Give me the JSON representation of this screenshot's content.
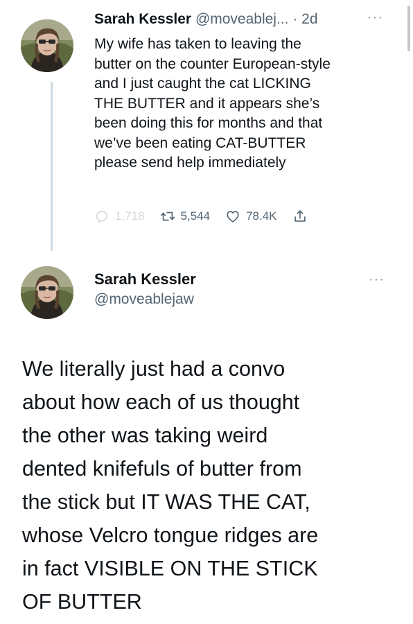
{
  "tweet1": {
    "author_name": "Sarah Kessler",
    "handle": "@moveablej...",
    "separator": "·",
    "time": "2d",
    "more": "···",
    "lines": [
      "My wife has taken to leaving the",
      "butter on the counter European-style",
      "and I just caught the cat LICKING",
      "THE BUTTER and it appears she’s",
      "been doing this for months and that",
      "we’ve been eating CAT-BUTTER",
      "please send help immediately"
    ],
    "actions": {
      "reply_count": "1,718",
      "retweet_count": "5,544",
      "like_count": "78.4K"
    }
  },
  "tweet2": {
    "author_name": "Sarah Kessler",
    "handle": "@moveablejaw",
    "more": "···",
    "lines": [
      "We literally just had a convo",
      "about how each of us thought",
      "the other was taking weird",
      "dented knifefuls of butter from",
      "the stick but IT WAS THE CAT,",
      "whose Velcro tongue ridges are",
      "in fact VISIBLE ON THE STICK",
      "OF BUTTER"
    ]
  },
  "icons": {
    "reply": "reply-icon",
    "retweet": "retweet-icon",
    "like": "heart-icon",
    "share": "share-icon",
    "more": "more-icon"
  },
  "colors": {
    "text": "#0f1419",
    "secondary": "#536471",
    "thread_line": "#cfd9de"
  }
}
